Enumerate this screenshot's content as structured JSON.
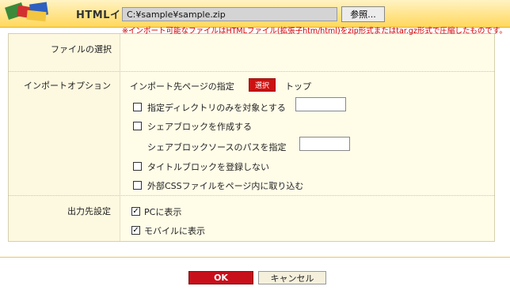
{
  "window": {
    "title": "HTMLインポートツール"
  },
  "file_select": {
    "label": "ファイルの選択",
    "path_value": "C:¥sample¥sample.zip",
    "browse_label": "参照...",
    "note": "※インポート可能なファイルはHTMLファイル(拡張子htm/html)をzip形式またはtar.gz形式で圧縮したものです。"
  },
  "import_options": {
    "label": "インポートオプション",
    "dest_label": "インポート先ページの指定",
    "select_label": "選択",
    "dest_value": "トップ",
    "only_dir_label": "指定ディレクトリのみを対象とする",
    "only_dir_checked": false,
    "create_share_label": "シェアブロックを作成する",
    "create_share_checked": false,
    "share_path_label": "シェアブロックソースのパスを指定",
    "no_title_label": "タイトルブロックを登録しない",
    "no_title_checked": false,
    "external_css_label": "外部CSSファイルをページ内に取り込む",
    "external_css_checked": false
  },
  "output": {
    "label": "出力先設定",
    "pc_label": "PCに表示",
    "pc_checked": true,
    "mobile_label": "モバイルに表示",
    "mobile_checked": true
  },
  "footer": {
    "ok_label": "OK",
    "cancel_label": "キャンセル"
  },
  "colors": {
    "accent_red": "#c8101b",
    "note_red": "#cc0000",
    "title_bar": "#ffd85c",
    "panel_bg": "#fffce8"
  }
}
